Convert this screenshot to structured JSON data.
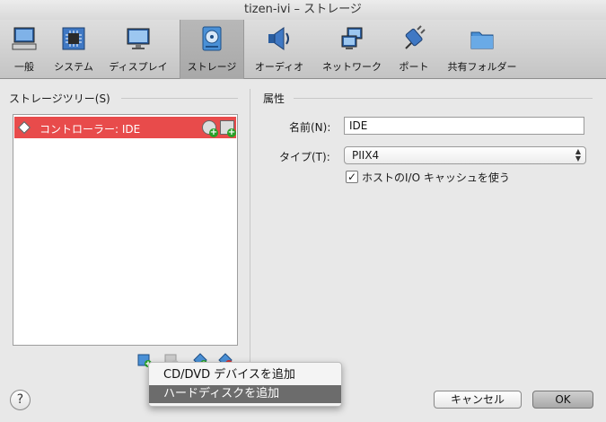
{
  "window": {
    "title": "tizen-ivi – ストレージ"
  },
  "toolbar": {
    "items": [
      {
        "label": "一般",
        "icon": "monitor-icon",
        "selected": false
      },
      {
        "label": "システム",
        "icon": "chip-icon",
        "selected": false
      },
      {
        "label": "ディスプレイ",
        "icon": "display-icon",
        "selected": false
      },
      {
        "label": "ストレージ",
        "icon": "storage-disk-icon",
        "selected": true
      },
      {
        "label": "オーディオ",
        "icon": "speaker-icon",
        "selected": false
      },
      {
        "label": "ネットワーク",
        "icon": "network-icon",
        "selected": false
      },
      {
        "label": "ポート",
        "icon": "port-plug-icon",
        "selected": false
      },
      {
        "label": "共有フォルダー",
        "icon": "folder-icon",
        "selected": false
      }
    ]
  },
  "storage_tree": {
    "header": "ストレージツリー(S)",
    "items": [
      {
        "label": "コントローラー: IDE",
        "selected": true,
        "icon": "controller-icon"
      }
    ],
    "row_icons": [
      "add-optical-drive-icon",
      "add-hard-disk-icon"
    ],
    "buttons": [
      "add-controller-icon",
      "remove-controller-icon",
      "add-attachment-icon",
      "remove-attachment-icon"
    ]
  },
  "attributes": {
    "header": "属性",
    "name_label": "名前(N):",
    "name_value": "IDE",
    "type_label": "タイプ(T):",
    "type_value": "PIIX4",
    "host_io_cache_label": "ホストのI/O キャッシュを使う",
    "host_io_cache_checked": true,
    "check_mark": "✓"
  },
  "popup_menu": {
    "items": [
      {
        "label": "CD/DVD デバイスを追加",
        "highlighted": false
      },
      {
        "label": "ハードディスクを追加",
        "highlighted": true
      }
    ]
  },
  "footer": {
    "help_label": "?",
    "cancel_label": "キャンセル",
    "ok_label": "OK"
  },
  "colors": {
    "selection_red": "#e84b4b",
    "menu_highlight": "#6c6c6c"
  }
}
